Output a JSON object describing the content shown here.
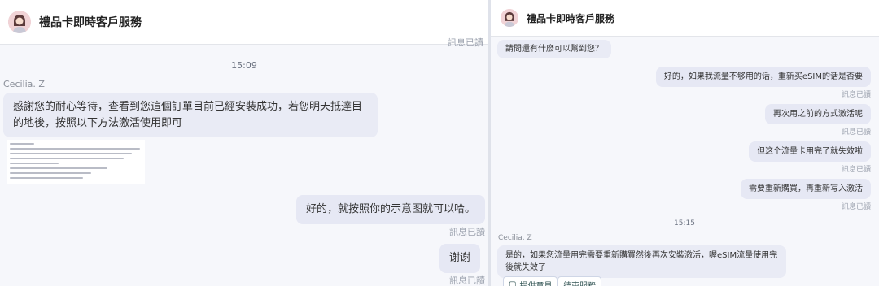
{
  "left": {
    "header": {
      "title": "禮品卡即時客戶服務"
    },
    "partial_read": "訊息已讀",
    "time": "15:09",
    "agent_name": "Cecilia. Z",
    "agent_message": "感謝您的耐心等待，查看到您這個訂單目前已經安裝成功，若您明天抵達目的地後，按照以下方法激活使用即可",
    "user_messages": [
      {
        "text": "好的，就按照你的示意图就可以哈。",
        "read": "訊息已讀"
      },
      {
        "text": "谢谢",
        "read": "訊息已讀"
      }
    ]
  },
  "right": {
    "header": {
      "title": "禮品卡即時客戶服務"
    },
    "first_agent_message": "請問還有什麼可以幫到您？",
    "user_messages": [
      {
        "text": "好的，如果我流量不够用的话，重新买eSIM的话是否要",
        "read": "訊息已讀"
      },
      {
        "text": "再次用之前的方式激活呢",
        "read": "訊息已讀"
      },
      {
        "text": "但这个流量卡用完了就失效啦",
        "read": "訊息已讀"
      },
      {
        "text": "需要重新購買，再重新写入激活",
        "read": "訊息已讀"
      }
    ],
    "time": "15:15",
    "agent_name": "Cecilia. Z",
    "agent_message": "是的，如果您流量用完需要重新購買然後再次安裝激活，喔eSIM流量使用完後就失效了",
    "buttons": [
      "提供意見",
      "結束服務"
    ]
  }
}
